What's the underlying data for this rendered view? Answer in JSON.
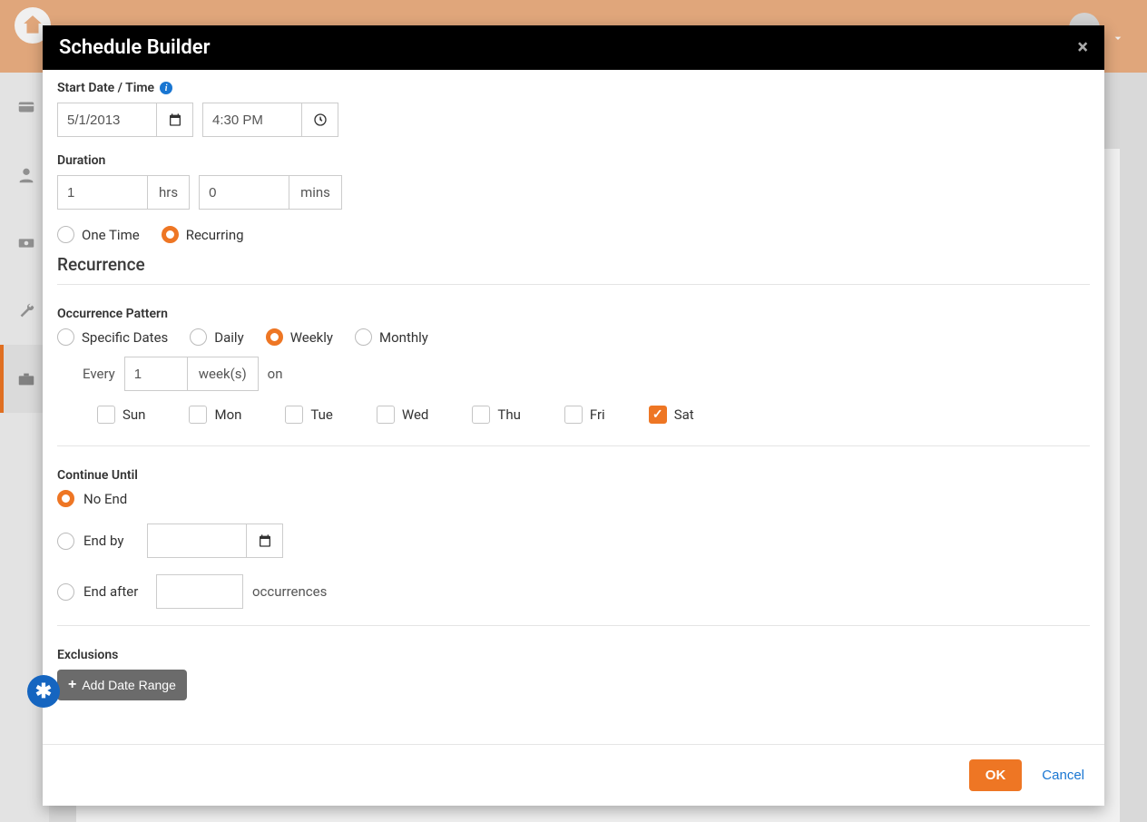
{
  "modal": {
    "title": "Schedule Builder",
    "labels": {
      "startDateTime": "Start Date / Time",
      "duration": "Duration",
      "hrs": "hrs",
      "mins": "mins",
      "oneTime": "One Time",
      "recurring": "Recurring",
      "recurrence": "Recurrence",
      "occurrencePattern": "Occurrence Pattern",
      "specificDates": "Specific Dates",
      "daily": "Daily",
      "weekly": "Weekly",
      "monthly": "Monthly",
      "every": "Every",
      "weeksUnit": "week(s)",
      "on": "on",
      "continueUntil": "Continue Until",
      "noEnd": "No End",
      "endBy": "End by",
      "endAfter": "End after",
      "occurrences": "occurrences",
      "exclusions": "Exclusions",
      "addDateRange": "Add Date Range"
    },
    "values": {
      "startDate": "5/1/2013",
      "startTime": "4:30 PM",
      "durationHrs": "1",
      "durationMins": "0",
      "scheduleType": "Recurring",
      "occurrencePattern": "Weekly",
      "everyN": "1",
      "days": {
        "Sun": false,
        "Mon": false,
        "Tue": false,
        "Wed": false,
        "Thu": false,
        "Fri": false,
        "Sat": true
      },
      "continueUntil": "No End",
      "endByDate": "",
      "endAfterCount": ""
    },
    "days": [
      "Sun",
      "Mon",
      "Tue",
      "Wed",
      "Thu",
      "Fri",
      "Sat"
    ],
    "footer": {
      "ok": "OK",
      "cancel": "Cancel"
    }
  }
}
